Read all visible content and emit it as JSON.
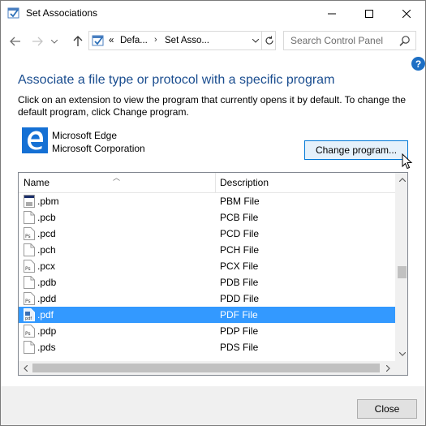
{
  "window": {
    "title": "Set Associations"
  },
  "address_bar": {
    "overflow": "«",
    "crumbs": [
      "Defa...",
      "Set Asso..."
    ]
  },
  "search": {
    "placeholder": "Search Control Panel"
  },
  "help": "?",
  "main": {
    "heading": "Associate a file type or protocol with a specific program",
    "description": "Click on an extension to view the program that currently opens it by default. To change the default program, click Change program.",
    "program": {
      "name": "Microsoft Edge",
      "vendor": "Microsoft Corporation"
    },
    "change_button": "Change program..."
  },
  "list": {
    "columns": [
      "Name",
      "Description"
    ],
    "rows": [
      {
        "name": ".pbm",
        "description": "PBM File",
        "icon": "image-file-icon"
      },
      {
        "name": ".pcb",
        "description": "PCB File",
        "icon": "blank-file-icon"
      },
      {
        "name": ".pcd",
        "description": "PCD File",
        "icon": "photoshop-file-icon"
      },
      {
        "name": ".pch",
        "description": "PCH File",
        "icon": "blank-file-icon"
      },
      {
        "name": ".pcx",
        "description": "PCX File",
        "icon": "photoshop-file-icon"
      },
      {
        "name": ".pdb",
        "description": "PDB File",
        "icon": "blank-file-icon"
      },
      {
        "name": ".pdd",
        "description": "PDD File",
        "icon": "photoshop-file-icon"
      },
      {
        "name": ".pdf",
        "description": "PDF File",
        "icon": "pdf-file-icon",
        "selected": true
      },
      {
        "name": ".pdp",
        "description": "PDP File",
        "icon": "photoshop-file-icon"
      },
      {
        "name": ".pds",
        "description": "PDS File",
        "icon": "blank-file-icon"
      }
    ]
  },
  "footer": {
    "close_button": "Close"
  },
  "colors": {
    "accent": "#0078d7",
    "heading": "#1a4d8f",
    "selection": "#3399ff",
    "edge_blue": "#1570d4"
  }
}
